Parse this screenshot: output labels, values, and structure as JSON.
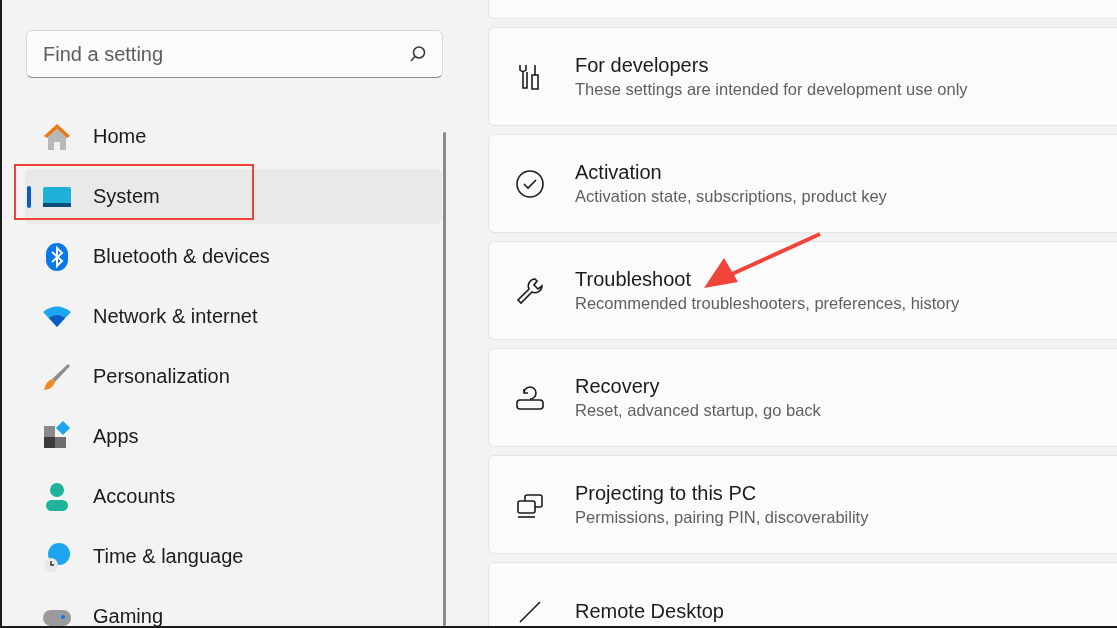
{
  "search": {
    "placeholder": "Find a setting"
  },
  "nav": [
    {
      "label": "Home",
      "selected": false
    },
    {
      "label": "System",
      "selected": true
    },
    {
      "label": "Bluetooth & devices",
      "selected": false
    },
    {
      "label": "Network & internet",
      "selected": false
    },
    {
      "label": "Personalization",
      "selected": false
    },
    {
      "label": "Apps",
      "selected": false
    },
    {
      "label": "Accounts",
      "selected": false
    },
    {
      "label": "Time & language",
      "selected": false
    },
    {
      "label": "Gaming",
      "selected": false
    }
  ],
  "cards": [
    {
      "kind": "blank"
    },
    {
      "kind": "setting",
      "title": "For developers",
      "subtitle": "These settings are intended for development use only"
    },
    {
      "kind": "setting",
      "title": "Activation",
      "subtitle": "Activation state, subscriptions, product key"
    },
    {
      "kind": "setting",
      "title": "Troubleshoot",
      "subtitle": "Recommended troubleshooters, preferences, history"
    },
    {
      "kind": "setting",
      "title": "Recovery",
      "subtitle": "Reset, advanced startup, go back"
    },
    {
      "kind": "setting",
      "title": "Projecting to this PC",
      "subtitle": "Permissions, pairing PIN, discoverability"
    },
    {
      "kind": "setting",
      "title": "Remote Desktop"
    }
  ],
  "annotations": [
    {
      "kind": "box"
    },
    {
      "kind": "arrow"
    }
  ]
}
